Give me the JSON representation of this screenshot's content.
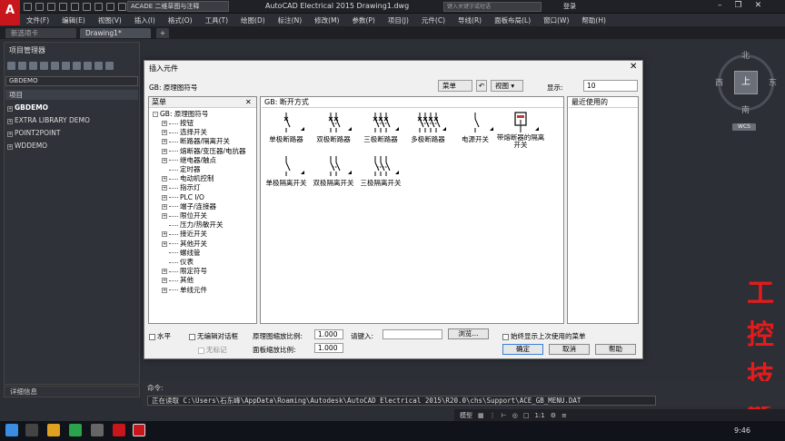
{
  "app": {
    "logo": "A",
    "workspace": "ACADE 二维草图与注释",
    "title": "AutoCAD Electrical 2015    Drawing1.dwg",
    "search_placeholder": "键入关键字或短语",
    "login": "登录"
  },
  "menubar": [
    "文件(F)",
    "编辑(E)",
    "视图(V)",
    "插入(I)",
    "格式(O)",
    "工具(T)",
    "绘图(D)",
    "标注(N)",
    "修改(M)",
    "参数(P)",
    "项目(J)",
    "元件(C)",
    "导线(R)",
    "面板布局(L)",
    "窗口(W)",
    "帮助(H)"
  ],
  "tabs": {
    "start": "新选项卡",
    "drawing": "Drawing1*",
    "add": "+"
  },
  "project_manager": {
    "title": "项目管理器",
    "selected": "GBDEMO",
    "header": "项目",
    "projects": [
      "GBDEMO",
      "EXTRA LIBRARY DEMO",
      "POINT2POINT",
      "WDDEMO"
    ],
    "detail": "详细信息"
  },
  "viewcube": {
    "north": "北",
    "south": "南",
    "east": "东",
    "west": "西",
    "top": "上",
    "wcs": "WCS"
  },
  "dialog": {
    "title": "插入元件",
    "subtitle": "GB: 原理图符号",
    "menu_btn": "菜单",
    "view_btn": "视图",
    "display_label": "显示:",
    "display_value": "10",
    "menu_header": "菜单",
    "tree_root": "GB: 原理图符号",
    "tree": [
      "按钮",
      "选择开关",
      "断路器/隔离开关",
      "熔断器/变压器/电抗器",
      "继电器/触点",
      "定时器",
      "电动机控制",
      "指示灯",
      "PLC I/O",
      "端子/连接器",
      "限位开关",
      "压力/热敏开关",
      "接近开关",
      "其他开关",
      "螺线管",
      "仪表",
      "限定符号",
      "其他",
      "单线元件"
    ],
    "mid_header": "GB: 断开方式",
    "symbols": [
      "单极断路器",
      "双极断路器",
      "三极断路器",
      "多极断路器",
      "电源开关",
      "带熔断器的隔离开关",
      "单极隔离开关",
      "双极隔离开关",
      "三极隔离开关"
    ],
    "recent_header": "最近使用的",
    "horizontal": "水平",
    "no_edit": "无编辑对话框",
    "no_tag": "无标记",
    "schematic_scale_label": "原理图缩放比例:",
    "schematic_scale": "1.000",
    "panel_scale_label": "面板缩放比例:",
    "panel_scale": "1.000",
    "enter_label": "请键入:",
    "browse": "浏览...",
    "always_show": "始终显示上次使用的菜单",
    "ok": "确定",
    "cancel": "取消",
    "help": "帮助"
  },
  "command": {
    "label": "命令:",
    "text": "正在读取 C:\\Users\\石东峰\\AppData\\Roaming\\Autodesk\\AutoCAD Electrical 2015\\R20.0\\chs\\Support\\ACE_GB_MENU.DAT"
  },
  "status": {
    "model": "模型",
    "scale": "1:1"
  },
  "taskbar": {
    "time": "9:46"
  },
  "watermark": [
    "工",
    "控",
    "技",
    "能"
  ],
  "colors": {
    "accent_red": "#c8161d",
    "dark_bg": "#2b2e35",
    "dialog_bg": "#f0f0f0"
  }
}
